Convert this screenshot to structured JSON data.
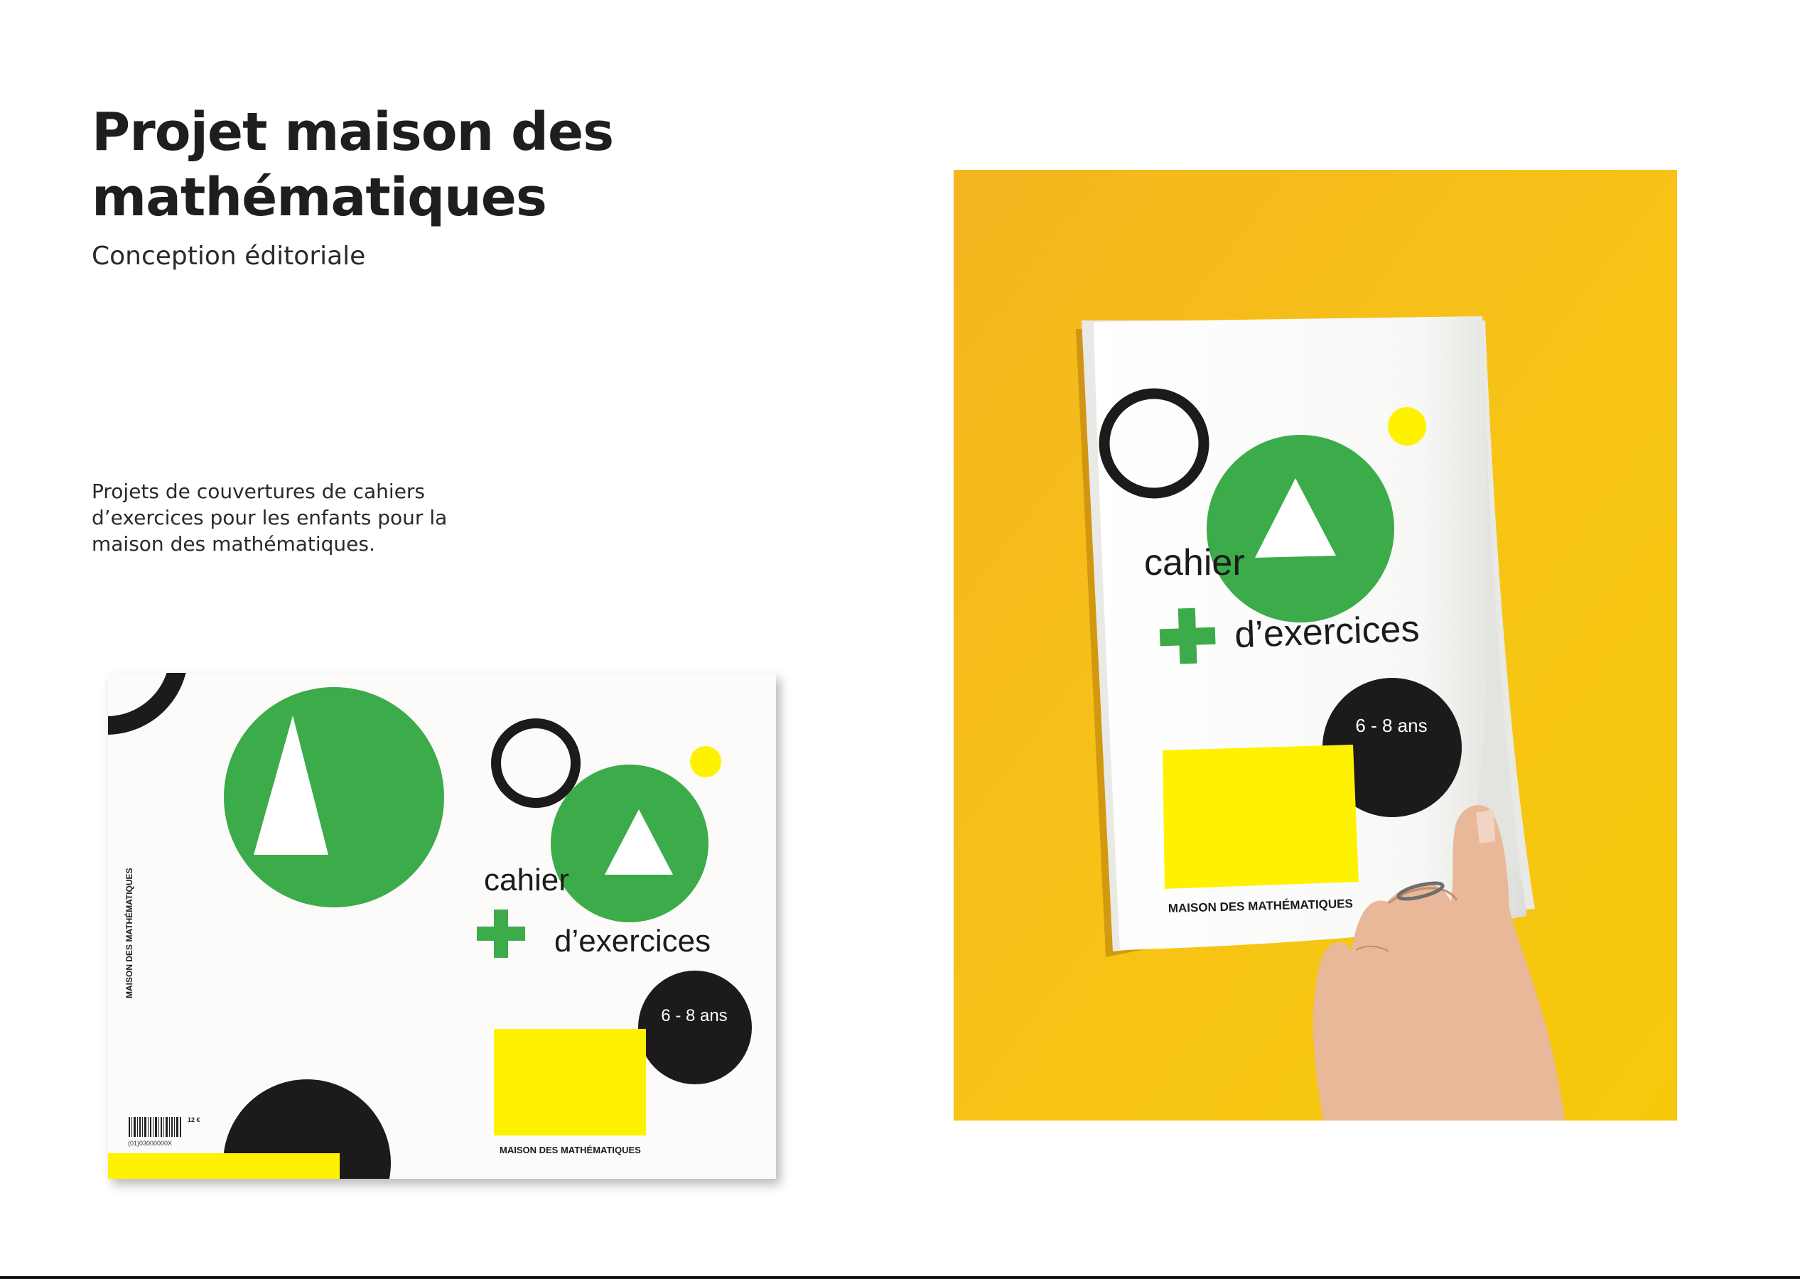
{
  "header": {
    "title": "Projet maison des mathématiques",
    "subtitle": "Conception éditoriale"
  },
  "description": "Projets de couvertures de cahiers d’exercices pour les enfants pour la maison des mathématiques.",
  "cover": {
    "title_line1": "cahier",
    "title_line2": "d’exercices",
    "age": "6 - 8 ans",
    "publisher": "MAISON DES MATHÉMATIQUES",
    "spine": "MAISON DES MATHÉMATIQUES",
    "price": "12 €",
    "barcode_number": "(01)03000000X"
  },
  "colors": {
    "green": "#3cab4a",
    "yellow": "#fff200",
    "black": "#1c1a1a",
    "photo_background": "#f5b81c"
  }
}
